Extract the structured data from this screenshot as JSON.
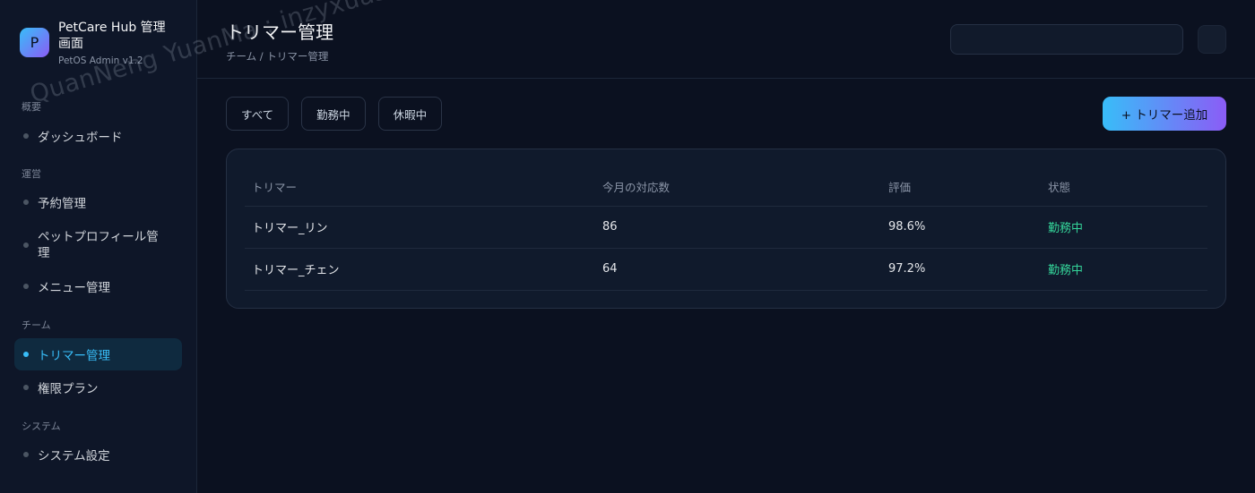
{
  "brand": {
    "logo_letter": "P",
    "title": "PetCare Hub 管理画面",
    "subtitle": "PetOS Admin v1.2"
  },
  "sidebar": {
    "sections": [
      {
        "label": "概要",
        "items": [
          {
            "label": "ダッシュボード",
            "active": false
          }
        ]
      },
      {
        "label": "運営",
        "items": [
          {
            "label": "予約管理",
            "active": false
          },
          {
            "label": "ペットプロフィール管理",
            "active": false
          },
          {
            "label": "メニュー管理",
            "active": false
          }
        ]
      },
      {
        "label": "チーム",
        "items": [
          {
            "label": "トリマー管理",
            "active": true
          },
          {
            "label": "権限プラン",
            "active": false
          }
        ]
      },
      {
        "label": "システム",
        "items": [
          {
            "label": "システム設定",
            "active": false
          }
        ]
      }
    ]
  },
  "header": {
    "title": "トリマー管理",
    "breadcrumb": "チーム / トリマー管理",
    "search_placeholder": ""
  },
  "filters": [
    "すべて",
    "勤務中",
    "休暇中"
  ],
  "add_button_label": "+ トリマー追加",
  "table": {
    "columns": [
      "トリマー",
      "今月の対応数",
      "評価",
      "状態"
    ],
    "rows": [
      [
        "トリマー_リン",
        "86",
        "98.6%",
        "勤務中"
      ],
      [
        "トリマー_チェン",
        "64",
        "97.2%",
        "勤務中"
      ]
    ]
  },
  "watermark": "QuanNeng YuanMa : inzyxuashop.com",
  "colors": {
    "accent": "#38bdf8",
    "accent_end": "#8b5cf6",
    "status_active": "#34d399",
    "background": "#0b1120"
  }
}
